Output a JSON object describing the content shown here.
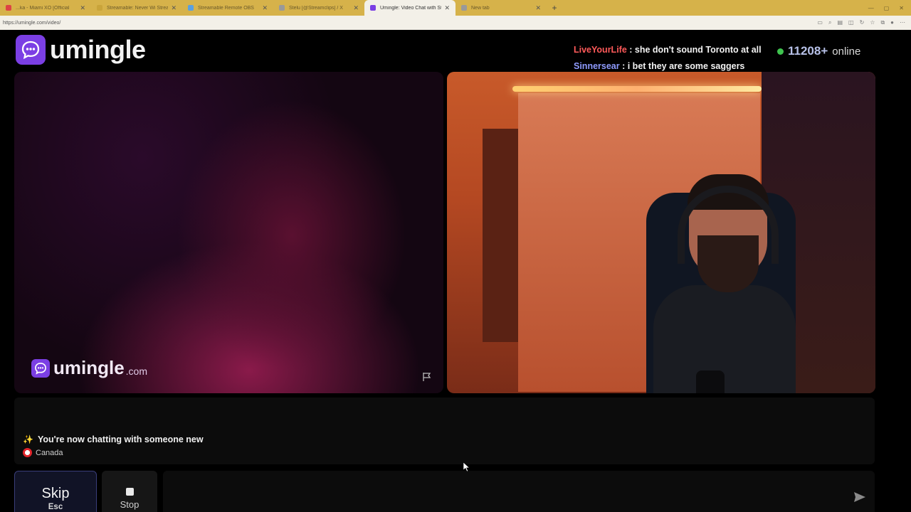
{
  "browser": {
    "tabs": [
      {
        "label": "...ka - Miami XO [Official",
        "active": false,
        "color": "#d44"
      },
      {
        "label": "Streamable: Never Wi Stream Wi",
        "active": false,
        "color": "#c9a43a"
      },
      {
        "label": "Streamable Remote OBS",
        "active": false,
        "color": "#5aa0e0"
      },
      {
        "label": "Stelu [@Streamclips] / X",
        "active": false,
        "color": "#999"
      },
      {
        "label": "Umingle: Video Chat with Stra",
        "active": true,
        "color": "#7b3fe4"
      },
      {
        "label": "New tab",
        "active": false,
        "color": "#999"
      }
    ],
    "url": "https://umingle.com/video/"
  },
  "header": {
    "logo_text": "umingle",
    "online_count": "11208+",
    "online_label": "online"
  },
  "chat_messages": [
    {
      "user": "LiveYourLife",
      "text": " : she don't sound Toronto at all"
    },
    {
      "user": "Sinnersear",
      "text": " : i bet they are some saggers"
    }
  ],
  "video": {
    "watermark_text": "umingle",
    "watermark_suffix": ".com"
  },
  "status": {
    "message": "You're now chatting with someone new",
    "country": "Canada"
  },
  "controls": {
    "skip_label": "Skip",
    "skip_key": "Esc",
    "stop_label": "Stop",
    "message_placeholder": ""
  },
  "colors": {
    "brand": "#7b3fe4",
    "online_dot": "#3fc34f",
    "user1": "#ff5a5a",
    "user2": "#8f9bff"
  }
}
